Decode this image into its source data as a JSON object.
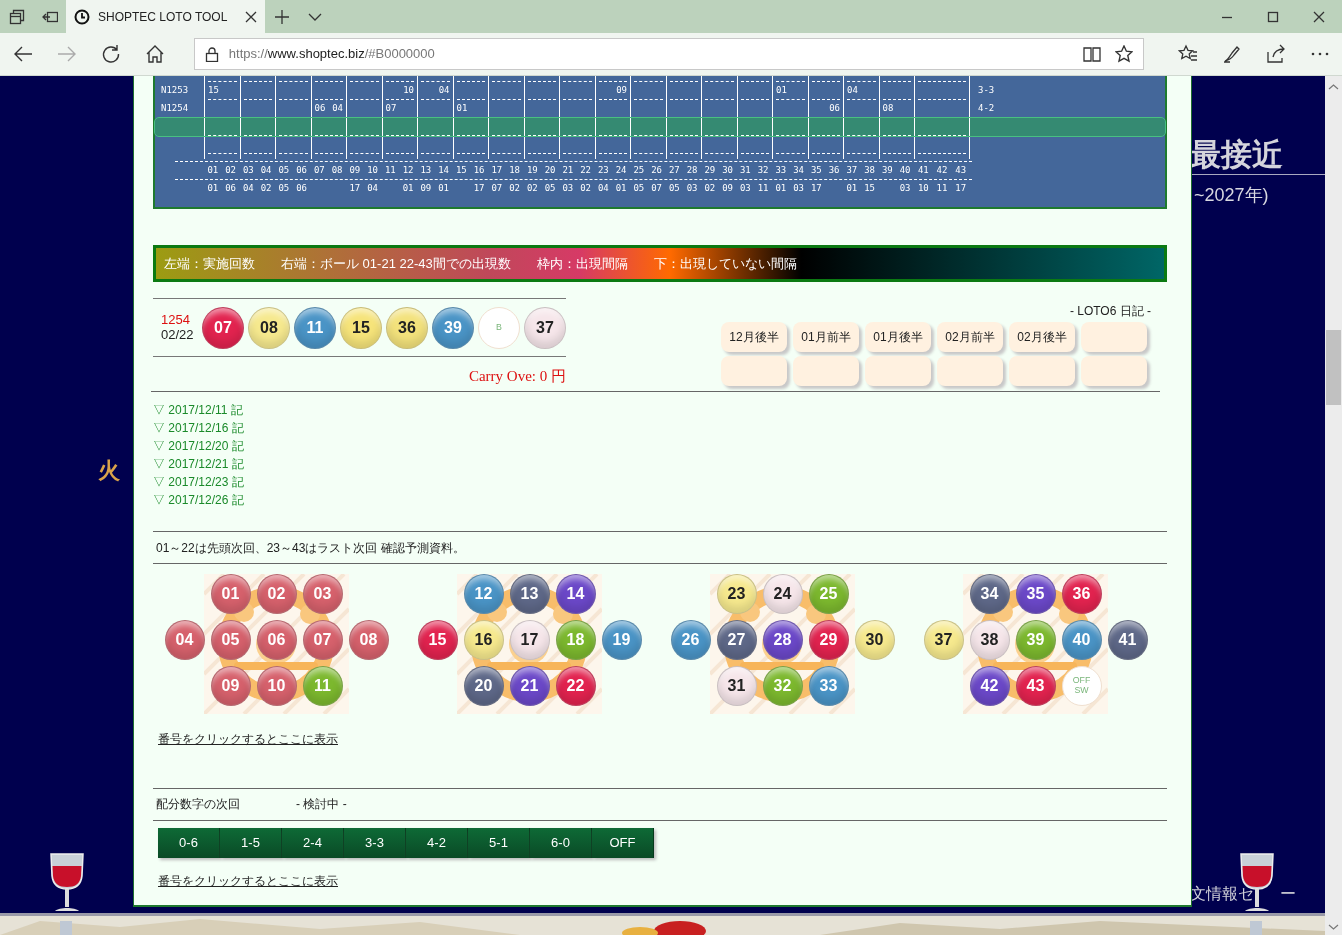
{
  "browser": {
    "tab_title": "SHOPTEC LOTO TOOL",
    "url_scheme": "https://",
    "url_host": "www.shoptec.biz",
    "url_path": "/#B0000000"
  },
  "side": {
    "left_text": "火",
    "right_title": "最接近",
    "right_subtitle": "~2027年)",
    "right_footer_start": "文情報セ",
    "right_footer_end": "ー"
  },
  "history_table": {
    "rows": [
      {
        "label": "N1253",
        "selected": false,
        "note": "3-3",
        "cells": [
          [
            "15",
            null
          ],
          [
            null,
            null
          ],
          [
            null,
            null
          ],
          [
            null,
            null
          ],
          [
            null,
            null
          ],
          [
            null,
            "10"
          ],
          [
            null,
            "04"
          ],
          [
            null,
            null
          ],
          [
            null,
            null
          ],
          [
            null,
            null
          ],
          [
            null,
            null
          ],
          [
            null,
            "09"
          ],
          [
            null,
            null
          ],
          [
            null,
            null
          ],
          [
            null,
            null
          ],
          [
            null,
            null
          ],
          [
            "01",
            null
          ],
          [
            null,
            null
          ],
          [
            "04",
            null
          ],
          [
            null,
            null
          ],
          [
            null,
            null
          ]
        ]
      },
      {
        "label": "N1254",
        "selected": false,
        "note": "4-2",
        "cells": [
          [
            null,
            null
          ],
          [
            null,
            null
          ],
          [
            null,
            null
          ],
          [
            "06",
            "04"
          ],
          [
            null,
            null
          ],
          [
            "07",
            null
          ],
          [
            null,
            null
          ],
          [
            "01",
            null
          ],
          [
            null,
            null
          ],
          [
            null,
            null
          ],
          [
            null,
            null
          ],
          [
            null,
            null
          ],
          [
            null,
            null
          ],
          [
            null,
            null
          ],
          [
            null,
            null
          ],
          [
            null,
            null
          ],
          [
            null,
            null
          ],
          [
            null,
            "06"
          ],
          [
            null,
            null
          ],
          [
            "08",
            null
          ],
          [
            null,
            null
          ]
        ]
      },
      {
        "selected": true
      },
      {
        "selected": false
      }
    ],
    "balls": [
      {
        "number": "01",
        "count": "01"
      },
      {
        "number": "02",
        "count": "06"
      },
      {
        "number": "03",
        "count": "04"
      },
      {
        "number": "04",
        "count": "02"
      },
      {
        "number": "05",
        "count": "05"
      },
      {
        "number": "06",
        "count": "06"
      },
      {
        "number": "07"
      },
      {
        "number": "08"
      },
      {
        "number": "09",
        "count": "17"
      },
      {
        "number": "10",
        "count": "04"
      },
      {
        "number": "11"
      },
      {
        "number": "12",
        "count": "01"
      },
      {
        "number": "13",
        "count": "09"
      },
      {
        "number": "14",
        "count": "01"
      },
      {
        "number": "15"
      },
      {
        "number": "16",
        "count": "17"
      },
      {
        "number": "17",
        "count": "07"
      },
      {
        "number": "18",
        "count": "02"
      },
      {
        "number": "19",
        "count": "02"
      },
      {
        "number": "20",
        "count": "05"
      },
      {
        "number": "21",
        "count": "03"
      },
      {
        "number": "22",
        "count": "02"
      },
      {
        "number": "23",
        "count": "04"
      },
      {
        "number": "24",
        "count": "01"
      },
      {
        "number": "25",
        "count": "05"
      },
      {
        "number": "26",
        "count": "07"
      },
      {
        "number": "27",
        "count": "05"
      },
      {
        "number": "28",
        "count": "03"
      },
      {
        "number": "29",
        "count": "02"
      },
      {
        "number": "30",
        "count": "09"
      },
      {
        "number": "31",
        "count": "03"
      },
      {
        "number": "32",
        "count": "11"
      },
      {
        "number": "33",
        "count": "01"
      },
      {
        "number": "34",
        "count": "03"
      },
      {
        "number": "35",
        "count": "17"
      },
      {
        "number": "36"
      },
      {
        "number": "37",
        "count": "01"
      },
      {
        "number": "38",
        "count": "15"
      },
      {
        "number": "39"
      },
      {
        "number": "40",
        "count": "03"
      },
      {
        "number": "41",
        "count": "10"
      },
      {
        "number": "42",
        "count": "11"
      },
      {
        "number": "43",
        "count": "17"
      }
    ]
  },
  "legend_bar": [
    "左端：実施回数",
    "右端：ボール 01-21 22-43間での出現数",
    "枠内：出現間隔",
    "下：出現していない間隔"
  ],
  "latest_draw": {
    "round": "1254",
    "date": "02/22",
    "carry_over": "Carry Ove: 0 円",
    "balls": [
      {
        "text": "07",
        "kind": "ball",
        "color": "#e2234f"
      },
      {
        "text": "08",
        "kind": "ball",
        "color": "#f6e98e"
      },
      {
        "text": "11",
        "kind": "ball",
        "color": "#4a94c6"
      },
      {
        "text": "15",
        "kind": "ball",
        "color": "#f6e47a"
      },
      {
        "text": "36",
        "kind": "ball",
        "color": "#f3e27c"
      },
      {
        "text": "39",
        "kind": "ball",
        "color": "#4a94c6"
      },
      {
        "text": "B",
        "kind": "plain"
      },
      {
        "text": "37",
        "kind": "ball",
        "color": "#f6e6ea"
      }
    ]
  },
  "diary": {
    "title": "- LOTO6 日記 -",
    "buttons": [
      {
        "kind": "labeled",
        "label": "12月後半"
      },
      {
        "kind": "labeled",
        "label": "01月前半"
      },
      {
        "kind": "labeled",
        "label": "01月後半"
      },
      {
        "kind": "labeled",
        "label": "02月前半"
      },
      {
        "kind": "labeled",
        "label": "02月後半"
      },
      {
        "kind": "blank"
      },
      {
        "kind": "blank"
      },
      {
        "kind": "blank"
      },
      {
        "kind": "blank"
      },
      {
        "kind": "blank"
      },
      {
        "kind": "blank"
      },
      {
        "kind": "blank"
      }
    ]
  },
  "diary_links": [
    "▽ 2017/12/11 記",
    "▽ 2017/12/16 記",
    "▽ 2017/12/20 記",
    "▽ 2017/12/21 記",
    "▽ 2017/12/23 記",
    "▽ 2017/12/26 記"
  ],
  "prediction": {
    "caption": "01～22は先頭次回、23～43はラスト次回 確認予測資料。",
    "hint_link": "番号をクリックするとここに表示",
    "clusters": [
      {
        "balls": [
          {
            "text": "01",
            "kind": "ball",
            "color": "#d6616c"
          },
          {
            "text": "02",
            "kind": "ball",
            "color": "#d6616c"
          },
          {
            "text": "03",
            "kind": "ball",
            "color": "#d6616c"
          },
          {
            "text": "04",
            "kind": "ball",
            "color": "#d6616c"
          },
          {
            "text": "05",
            "kind": "ball",
            "color": "#d6616c"
          },
          {
            "text": "06",
            "kind": "ball",
            "color": "#d6616c"
          },
          {
            "text": "07",
            "kind": "ball",
            "color": "#d6616c"
          },
          {
            "text": "08",
            "kind": "ball",
            "color": "#d6616c"
          },
          {
            "text": "09",
            "kind": "ball",
            "color": "#d6616c"
          },
          {
            "text": "10",
            "kind": "ball",
            "color": "#d6616c"
          },
          {
            "text": "11",
            "kind": "ball",
            "color": "#7cb82e"
          }
        ]
      },
      {
        "balls": [
          {
            "text": "12",
            "kind": "ball",
            "color": "#4a94c6"
          },
          {
            "text": "13",
            "kind": "ball",
            "color": "#5e6888"
          },
          {
            "text": "14",
            "kind": "ball",
            "color": "#6b48c8"
          },
          {
            "text": "15",
            "kind": "ball",
            "color": "#e2234f"
          },
          {
            "text": "16",
            "kind": "ball",
            "color": "#f6e98e"
          },
          {
            "text": "17",
            "kind": "ball",
            "color": "#f6e6ea"
          },
          {
            "text": "18",
            "kind": "ball",
            "color": "#7cb82e"
          },
          {
            "text": "19",
            "kind": "ball",
            "color": "#4a94c6"
          },
          {
            "text": "20",
            "kind": "ball",
            "color": "#5e6888"
          },
          {
            "text": "21",
            "kind": "ball",
            "color": "#6b48c8"
          },
          {
            "text": "22",
            "kind": "ball",
            "color": "#e2234f"
          }
        ]
      },
      {
        "balls": [
          {
            "text": "23",
            "kind": "ball",
            "color": "#f6e98e"
          },
          {
            "text": "24",
            "kind": "ball",
            "color": "#f6e6ea"
          },
          {
            "text": "25",
            "kind": "ball",
            "color": "#7cb82e"
          },
          {
            "text": "26",
            "kind": "ball",
            "color": "#4a94c6"
          },
          {
            "text": "27",
            "kind": "ball",
            "color": "#5e6888"
          },
          {
            "text": "28",
            "kind": "ball",
            "color": "#6b48c8"
          },
          {
            "text": "29",
            "kind": "ball",
            "color": "#e2234f"
          },
          {
            "text": "30",
            "kind": "ball",
            "color": "#f6e98e"
          },
          {
            "text": "31",
            "kind": "ball",
            "color": "#f6e6ea"
          },
          {
            "text": "32",
            "kind": "ball",
            "color": "#7cb82e"
          },
          {
            "text": "33",
            "kind": "ball",
            "color": "#4a94c6"
          }
        ]
      },
      {
        "balls": [
          {
            "text": "34",
            "kind": "ball",
            "color": "#5e6888"
          },
          {
            "text": "35",
            "kind": "ball",
            "color": "#6b48c8"
          },
          {
            "text": "36",
            "kind": "ball",
            "color": "#e2234f"
          },
          {
            "text": "37",
            "kind": "ball",
            "color": "#f6e98e"
          },
          {
            "text": "38",
            "kind": "ball",
            "color": "#f6e6ea"
          },
          {
            "text": "39",
            "kind": "ball",
            "color": "#7cb82e"
          },
          {
            "text": "40",
            "kind": "ball",
            "color": "#4a94c6"
          },
          {
            "text": "41",
            "kind": "ball",
            "color": "#5e6888"
          },
          {
            "text": "42",
            "kind": "ball",
            "color": "#6b48c8"
          },
          {
            "text": "43",
            "kind": "ball",
            "color": "#e2234f"
          },
          {
            "text": "OFF SW",
            "kind": "plain"
          }
        ]
      }
    ]
  },
  "distribution": {
    "label": "配分数字の次回",
    "status": "- 検討中 -",
    "buttons": [
      "0-6",
      "1-5",
      "2-4",
      "3-3",
      "4-2",
      "5-1",
      "6-0",
      "OFF"
    ],
    "hint_link": "番号をクリックするとここに表示"
  }
}
